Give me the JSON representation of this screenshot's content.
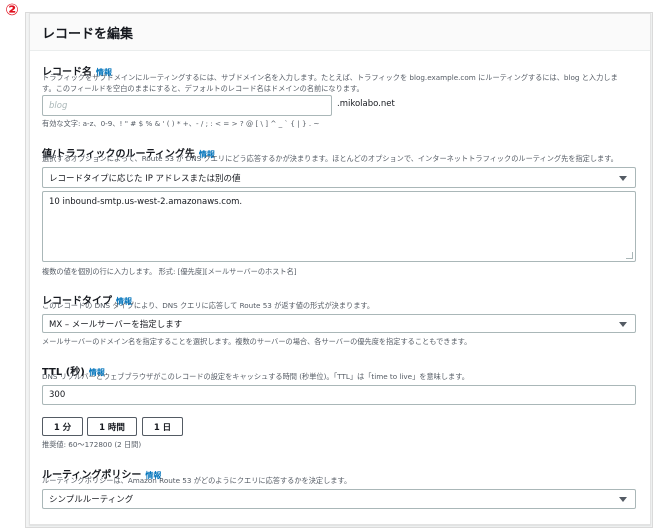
{
  "step_marker": "②",
  "panel": {
    "title": "レコードを編集"
  },
  "record_name": {
    "label": "レコード名",
    "info": "情報",
    "desc1": "トラフィックをサブドメインにルーティングするには、サブドメイン名を入力します。たとえば、トラフィックを blog.example.com にルーティングするには、blog と入力しま",
    "desc2": "す。このフィールドを空白のままにすると、デフォルトのレコード名はドメインの名前になります。",
    "placeholder": "blog",
    "suffix": ".mikolabo.net",
    "valid_chars": "有効な文字: a-z、0-9、! \" # $ % & ' ( ) * +、- / ; : < = > ? @ [ \\ ] ^ _ ` { | } . ~"
  },
  "value": {
    "label": "値/トラフィックのルーティング先",
    "info": "情報",
    "desc": "選択するオプションによって、Route 53 が DNS クエリにどう応答するかが決まります。ほとんどのオプションで、インターネットトラフィックのルーティング先を指定します。",
    "select": "レコードタイプに応じた IP アドレスまたは別の値",
    "textarea": "10 inbound-smtp.us-west-2.amazonaws.com.",
    "hint": "複数の値を個別の行に入力します。 形式: [優先度][メールサーバーのホスト名]"
  },
  "record_type": {
    "label": "レコードタイプ",
    "info": "情報",
    "desc": "このレコードの DNS タイプにより、DNS クエリに応答して Route 53 が返す値の形式が決まります。",
    "select": "MX – メールサーバーを指定します",
    "hint": "メールサーバーのドメイン名を指定することを選択します。複数のサーバーの場合、各サーバーの優先度を指定することもできます。"
  },
  "ttl": {
    "label": "TTL (秒)",
    "info": "情報",
    "desc": "DNS リゾルバーとウェブブラウザがこのレコードの設定をキャッシュする時間 (秒単位)。「TTL」は「time to live」を意味します。",
    "value": "300",
    "buttons": [
      "1 分",
      "1 時間",
      "1 日"
    ],
    "recommended": "推奨値: 60～172800 (2 日間)"
  },
  "routing_policy": {
    "label": "ルーティングポリシー",
    "info": "情報",
    "desc": "ルーティングポリシーは、Amazon Route 53 がどのようにクエリに応答するかを決定します。",
    "select": "シンプルルーティング"
  },
  "colors": {
    "accent": "#0073bb",
    "marker": "#e0101e",
    "border": "#aab7b8"
  },
  "icons": {
    "dropdown": "caret-down-icon"
  }
}
